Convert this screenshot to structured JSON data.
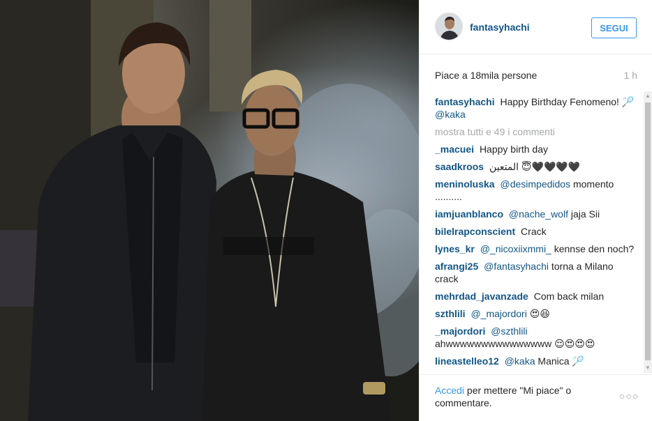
{
  "header": {
    "username": "fantasyhachi",
    "follow_label": "SEGUI"
  },
  "stats": {
    "likes": "Piace a 18mila persone",
    "time": "1 h"
  },
  "caption": {
    "user": "fantasyhachi",
    "text": "Happy Birthday Fenomeno! 🏸",
    "mention": "@kaka"
  },
  "show_all": "mostra tutti e 49 i commenti",
  "comments": [
    {
      "user": "_macuei",
      "mention": "",
      "text": "Happy birth day"
    },
    {
      "user": "saadkroos",
      "mention": "",
      "text": "المتعين 😇🖤🖤🖤🖤"
    },
    {
      "user": "meninoluska",
      "mention": "@desimpedidos",
      "text": "momento .........."
    },
    {
      "user": "iamjuanblanco",
      "mention": "@nache_wolf",
      "text": "jaja Sii"
    },
    {
      "user": "bilelrapconscient",
      "mention": "",
      "text": "Crack"
    },
    {
      "user": "lynes_kr",
      "mention": "@_nicoxiixmmi_",
      "text": "kennse den noch?"
    },
    {
      "user": "afrangi25",
      "mention": "@fantasyhachi",
      "text": "torna a Milano crack"
    },
    {
      "user": "mehrdad_javanzade",
      "mention": "",
      "text": "Com back milan"
    },
    {
      "user": "szthlili",
      "mention": "@_majordori",
      "text": "😍😆"
    },
    {
      "user": "_majordori",
      "mention": "@szthlili",
      "text": "ahwwwwwwwwwwwwwww 😌😍😍😍"
    },
    {
      "user": "lineastelleo12",
      "mention": "@kaka",
      "text": "Manica 🏸"
    }
  ],
  "footer": {
    "login_link": "Accedi",
    "login_text": " per mettere \"Mi piace\" o commentare.",
    "more": "○○○"
  }
}
